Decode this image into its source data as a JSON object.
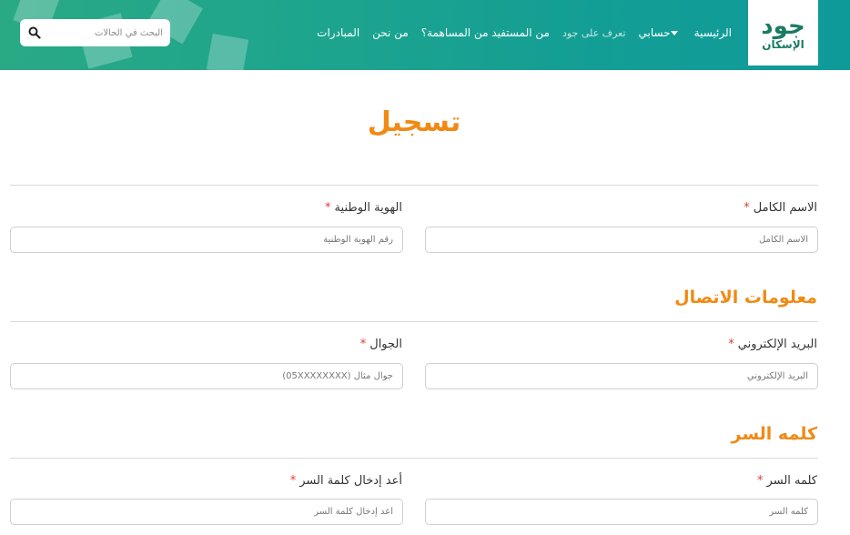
{
  "header": {
    "logo_main": "جود",
    "logo_sub": "الإسكان",
    "nav": {
      "home": "الرئيسية",
      "account": "حسابي",
      "about": "تعرف على جود",
      "beneficiary": "من المستفيد من المساهمة؟",
      "who_we_are": "من نحن",
      "initiatives": "المبادرات"
    },
    "search_placeholder": "البحث في الحالات"
  },
  "page_title": "تسجيل",
  "personal": {
    "full_name_label": "الاسم الكامل",
    "full_name_placeholder": "الاسم الكامل",
    "national_id_label": "الهوية الوطنية",
    "national_id_placeholder": "رقم الهوية الوطنية"
  },
  "contact": {
    "title": "معلومات الاتصال",
    "email_label": "البريد الإلكتروني",
    "email_placeholder": "البريد الإلكتروني",
    "mobile_label": "الجوال",
    "mobile_placeholder": "جوال مثال (05XXXXXXXX)"
  },
  "password_section": {
    "title": "كلمه السر",
    "password_label": "كلمه السر",
    "password_placeholder": "كلمه السر",
    "confirm_label": "أعد إدخال كلمة السر",
    "confirm_placeholder": "أعد إدخال كلمة السر"
  },
  "required_mark": "*",
  "colors": {
    "header_start": "#2aa985",
    "header_end": "#0f9a9a",
    "accent_orange": "#f08a14",
    "required_red": "#e23b3b"
  }
}
